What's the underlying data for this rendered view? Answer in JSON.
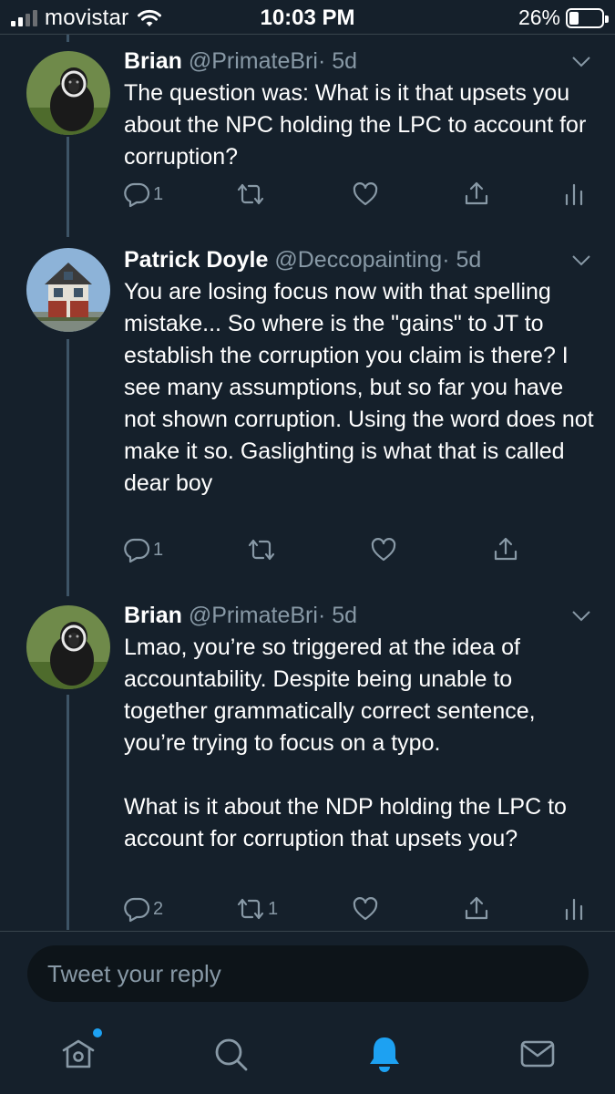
{
  "status_bar": {
    "carrier": "movistar",
    "time": "10:03 PM",
    "battery_percent": "26%",
    "battery_level": 0.26,
    "signal_bars_filled": 2,
    "signal_bars_total": 4
  },
  "colors": {
    "background": "#15202b",
    "secondary_text": "#8899a6",
    "accent": "#1da1f2",
    "thread_line": "#3d5466",
    "divider": "#38444d"
  },
  "tweets": [
    {
      "name": "Brian",
      "handle": "@PrimateBri",
      "time": "· 5d",
      "text": "The question was: What is it that upsets you about the NPC holding the LPC to account for corruption?",
      "reply_count": "1",
      "retweet_count": "",
      "avatar": "gibbon-avatar"
    },
    {
      "name": "Patrick Doyle",
      "handle": "@Deccopainting",
      "time": "· 5d",
      "text": "You are losing focus now with that spelling mistake... So where is the \"gains\" to JT to establish the corruption you claim is there? I see many assumptions, but so far you have not shown corruption. Using the word does not make it so. Gaslighting is what that is called dear boy",
      "reply_count": "1",
      "retweet_count": "",
      "avatar": "house-avatar"
    },
    {
      "name": "Brian",
      "handle": "@PrimateBri",
      "time": "· 5d",
      "text": "Lmao, you’re so triggered at the idea of accountability. Despite being unable to together grammatically correct sentence, you’re trying to focus on a typo.\n\nWhat is it about the NDP holding the LPC to account for corruption that upsets you?",
      "reply_count": "2",
      "retweet_count": "1",
      "avatar": "gibbon-avatar"
    }
  ],
  "reply_box": {
    "placeholder": "Tweet your reply"
  },
  "tabbar": {
    "items": [
      "home-icon",
      "search-icon",
      "notifications-icon",
      "messages-icon"
    ],
    "active": "notifications-icon"
  }
}
